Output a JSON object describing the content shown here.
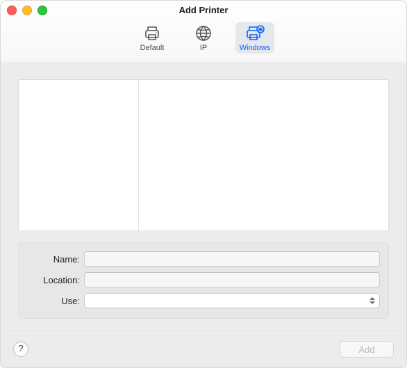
{
  "window": {
    "title": "Add Printer"
  },
  "toolbar": {
    "default_label": "Default",
    "ip_label": "IP",
    "windows_label": "Windows",
    "active": "windows"
  },
  "browser": {
    "servers": [],
    "shares": []
  },
  "form": {
    "name_label": "Name:",
    "name_value": "",
    "location_label": "Location:",
    "location_value": "",
    "use_label": "Use:",
    "use_value": "",
    "use_options": []
  },
  "footer": {
    "help_label": "?",
    "add_label": "Add",
    "add_enabled": false
  },
  "icons": {
    "printer": "printer-icon",
    "globe": "globe-icon",
    "windows_printer": "windows-printer-icon"
  }
}
